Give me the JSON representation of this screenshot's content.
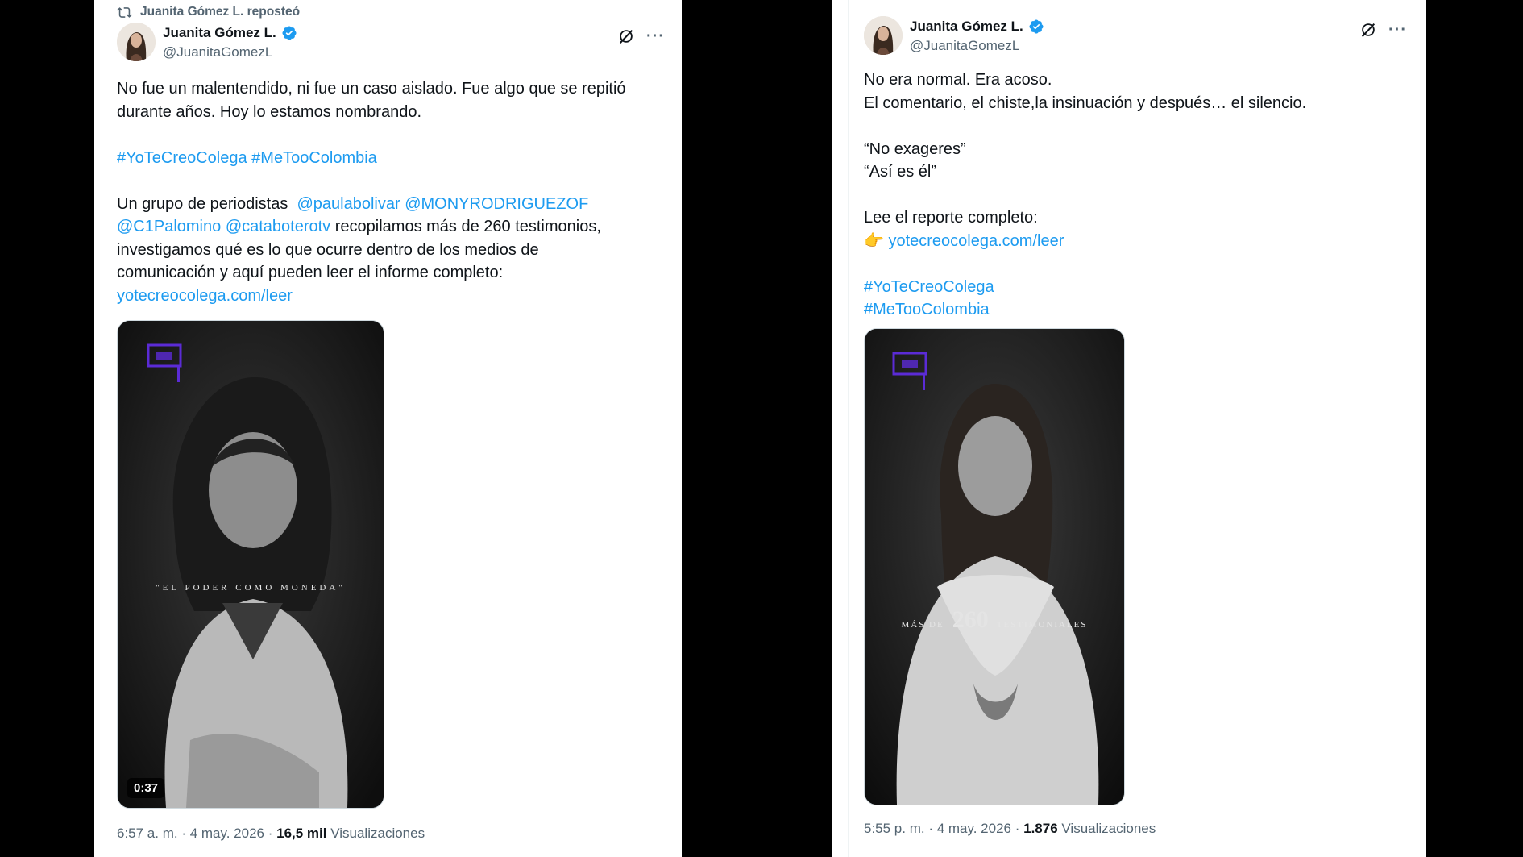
{
  "left_tweet": {
    "repost_label": "Juanita Gómez L. reposteó",
    "author_name": "Juanita Gómez L.",
    "author_handle": "@JuanitaGomezL",
    "text_line_1": "No fue un malentendido, ni fue un caso aislado. Fue algo que se repitió",
    "text_line_2": "durante años. Hoy lo estamos nombrando.",
    "hashtag_1": "#YoTeCreoColega",
    "hashtag_2": "#MeTooColombia",
    "grupo_text": "Un grupo de periodistas",
    "mention_1": "@paulabolivar",
    "mention_2": "@MONYRODRIGUEZOF",
    "mention_3": "@C1Palomino",
    "mention_4": "@cataboterotv",
    "text_after_mentions": "recopilamos más de 260 testimonios,",
    "text_line_7": "investigamos qué es lo que ocurre dentro de los medios de",
    "text_line_8": "comunicación y aquí pueden leer el informe completo:",
    "link_text": "yotecreocolega.com/leer",
    "video_overlay_text": "\"EL PODER COMO MONEDA\"",
    "video_duration": "0:37",
    "timestamp": "6:57 a. m. · 4 may. 2026 · ",
    "view_count": "16,5 mil",
    "views_label": "Visualizaciones"
  },
  "right_tweet": {
    "author_name": "Juanita Gómez L.",
    "author_handle": "@JuanitaGomezL",
    "text_line_1": "No era normal. Era acoso.",
    "text_line_2": "El comentario, el chiste,la insinuación y después… el silencio.",
    "quote_1": "“No exageres”",
    "quote_2": "“Así es él”",
    "read_text": "Lee el reporte completo:",
    "pointing_emoji": "👉",
    "link_text": "yotecreocolega.com/leer",
    "hashtag_1": "#YoTeCreoColega",
    "hashtag_2": "#MeTooColombia",
    "video_overlay_prefix": "MÁS DE",
    "video_overlay_number": "260",
    "video_overlay_suffix": "TESTIMONIALES",
    "timestamp": "5:55 p. m. · 4 may. 2026 · ",
    "view_count": "1.876",
    "views_label": "Visualizaciones"
  },
  "colors": {
    "link": "#1d9bf0",
    "text": "#0f1419",
    "secondary": "#536471",
    "logo_purple": "#5b2bd6"
  },
  "icons": [
    "repost-icon",
    "verified-badge-icon",
    "grok-icon",
    "more-options-icon"
  ]
}
